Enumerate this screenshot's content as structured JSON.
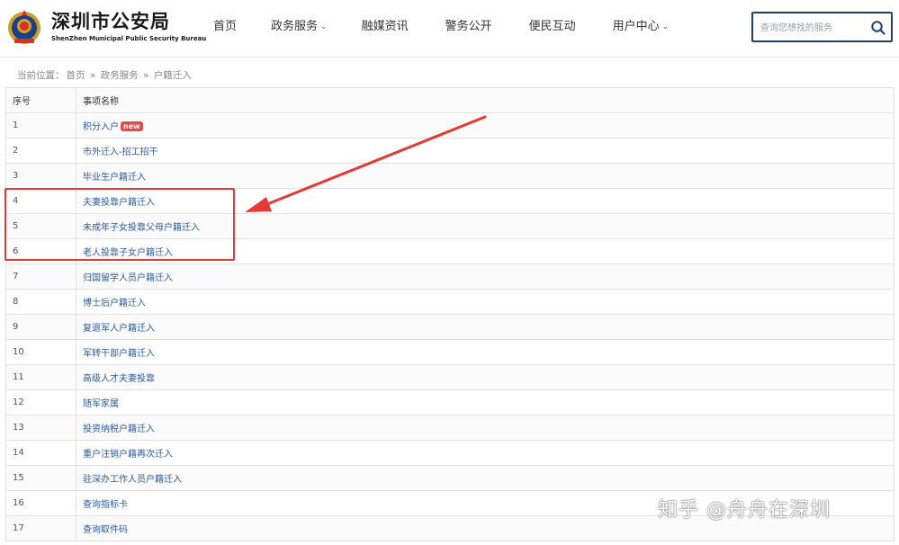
{
  "header": {
    "title": "深圳市公安局",
    "subtitle": "ShenZhen Municipal Public Security Bureau"
  },
  "nav": [
    {
      "label": "首页",
      "dropdown": false
    },
    {
      "label": "政务服务",
      "dropdown": true
    },
    {
      "label": "融媒资讯",
      "dropdown": false
    },
    {
      "label": "警务公开",
      "dropdown": false
    },
    {
      "label": "便民互动",
      "dropdown": false
    },
    {
      "label": "用户中心",
      "dropdown": true
    }
  ],
  "search": {
    "placeholder": "查询您想找的服务",
    "value": ""
  },
  "breadcrumb": {
    "prefix": "当前位置：",
    "items": [
      "首页",
      "政务服务",
      "户籍迁入"
    ],
    "separator": "»"
  },
  "table": {
    "headers": [
      "序号",
      "事项名称"
    ],
    "rows": [
      {
        "num": "1",
        "name": "积分入户",
        "badge": "new"
      },
      {
        "num": "2",
        "name": "市外迁入-招工招干"
      },
      {
        "num": "3",
        "name": "毕业生户籍迁入"
      },
      {
        "num": "4",
        "name": "夫妻投靠户籍迁入"
      },
      {
        "num": "5",
        "name": "未成年子女投靠父母户籍迁入"
      },
      {
        "num": "6",
        "name": "老人投靠子女户籍迁入"
      },
      {
        "num": "7",
        "name": "归国留学人员户籍迁入"
      },
      {
        "num": "8",
        "name": "博士后户籍迁入"
      },
      {
        "num": "9",
        "name": "复退军人户籍迁入"
      },
      {
        "num": "10",
        "name": "军转干部户籍迁入"
      },
      {
        "num": "11",
        "name": "高级人才夫妻投靠"
      },
      {
        "num": "12",
        "name": "随军家属"
      },
      {
        "num": "13",
        "name": "投资纳税户籍迁入"
      },
      {
        "num": "14",
        "name": "重户注销户籍再次迁入"
      },
      {
        "num": "15",
        "name": "驻深办工作人员户籍迁入"
      },
      {
        "num": "16",
        "name": "查询指标卡"
      },
      {
        "num": "17",
        "name": "查询取件码"
      }
    ]
  },
  "annotation": {
    "color": "#e53935",
    "highlighted_rows": [
      "4",
      "5",
      "6"
    ]
  },
  "watermark": "知乎 @舟舟在深圳",
  "colors": {
    "link": "#2f5a9b",
    "badge": "#e54a4a",
    "search_border": "#1f3f72"
  }
}
